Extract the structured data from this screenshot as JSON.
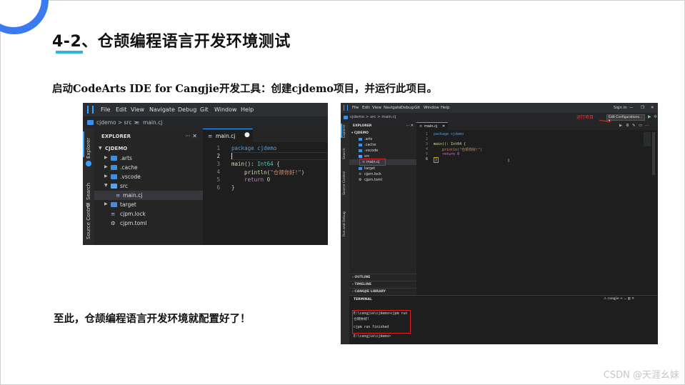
{
  "slide": {
    "title": "4-2、仓颉编程语言开发环境测试",
    "instruction": "启动CodeArts IDE for Cangjie开发工具：创建cjdemo项目，并运行此项目。",
    "conclusion": "至此，仓颉编程语言开发环境就配置好了！",
    "watermark": "CSDN @天涯幺妹",
    "accent_color": "#3b7bf2",
    "underline_color": "#2fb6d6"
  },
  "ide1": {
    "menu": [
      "File",
      "Edit",
      "View",
      "Navigate",
      "Debug",
      "Git",
      "Window",
      "Help"
    ],
    "breadcrumb": "cjdemo > src > ",
    "breadcrumb_file": "main.cj",
    "activity": [
      "Explorer",
      "Search",
      "Source Control"
    ],
    "explorer_title": "EXPLORER",
    "explorer_actions": "··· ✕",
    "tree": [
      {
        "label": "CJDEMO",
        "kind": "root"
      },
      {
        "label": ".arts",
        "kind": "folder"
      },
      {
        "label": ".cache",
        "kind": "folder"
      },
      {
        "label": ".vscode",
        "kind": "folder"
      },
      {
        "label": "src",
        "kind": "folder-open"
      },
      {
        "label": "main.cj",
        "kind": "file",
        "selected": true
      },
      {
        "label": "target",
        "kind": "folder"
      },
      {
        "label": "cjpm.lock",
        "kind": "file"
      },
      {
        "label": "cjpm.toml",
        "kind": "settings-file"
      }
    ],
    "tab_label": "main.cj",
    "line_numbers": [
      "1",
      "2",
      "3",
      "4",
      "5",
      "6"
    ],
    "code": {
      "l1_kw": "package",
      "l1_name": " cjdemo",
      "l3_fn": "main",
      "l3_rest": "(): ",
      "l3_type": "Int64",
      "l3_brace": " {",
      "l4_fn": "    println",
      "l4_open": "(",
      "l4_str": "\"仓颉你好!\"",
      "l4_close": ")",
      "l5_kw": "    return",
      "l5_num": " 0",
      "l6": "}"
    }
  },
  "ide2": {
    "menu": [
      "File",
      "Edit",
      "View",
      "Navigate",
      "Debug",
      "Git",
      "Window",
      "Help"
    ],
    "sign_in": "Sign in",
    "breadcrumb": "cjdemo > src > main.cj",
    "edit_config": "Edit Configurations...",
    "run_annotation": "运行项目",
    "activity": [
      "Explorer",
      "Search",
      "Source Control",
      "Run and Debug"
    ],
    "explorer_title": "EXPLORER",
    "tree": [
      {
        "label": "CJDEMO"
      },
      {
        "label": ".arts"
      },
      {
        "label": ".cache"
      },
      {
        "label": ".vscode"
      },
      {
        "label": "src"
      },
      {
        "label": "main.cj"
      },
      {
        "label": "target"
      },
      {
        "label": "cjpm.lock"
      },
      {
        "label": "cjpm.toml"
      }
    ],
    "panels": [
      "OUTLINE",
      "TIMELINE",
      "CANGJIE LIBRARY"
    ],
    "tab_label": "main.cj",
    "line_numbers": [
      "1",
      "2",
      "3",
      "4",
      "5",
      "6"
    ],
    "code": {
      "l1": "package cjdemo",
      "l3": "main(): Int64 {",
      "l4": "    println(\"仓颉你好!\")",
      "l5": "    return 0",
      "l6": "}"
    },
    "terminal_title": "TERMINAL",
    "terminal_tab": "cangjie",
    "terminal_lines": [
      "E:\\cangjie\\cjdemo>cjpm run",
      "仓颉你好!",
      "",
      "cjpm run finished",
      "",
      "E:\\cangjie\\cjdemo>"
    ]
  }
}
